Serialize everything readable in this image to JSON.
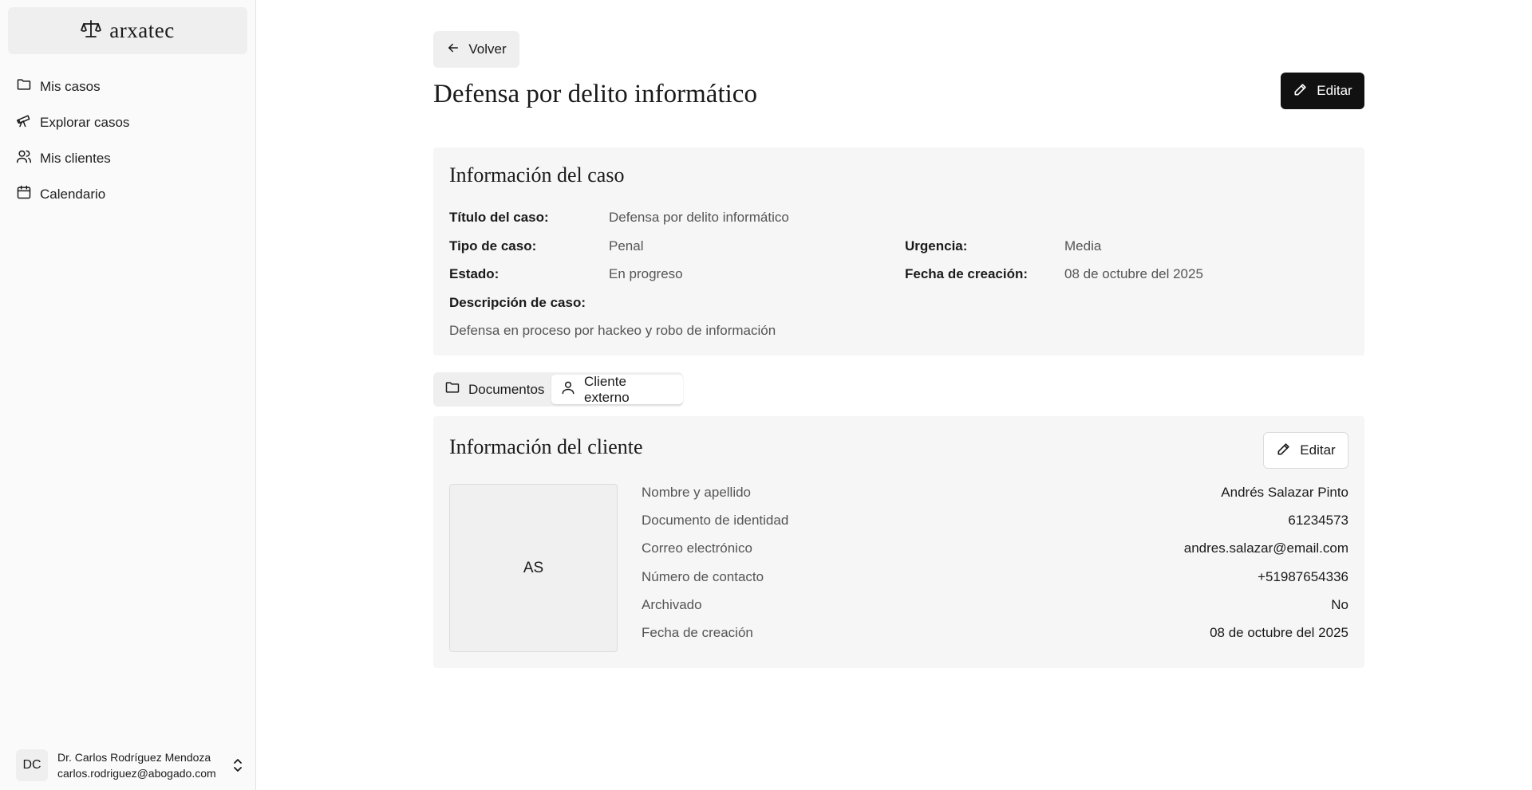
{
  "sidebar": {
    "brand": "arxatec",
    "nav": [
      {
        "label": "Mis casos",
        "icon": "folder-icon"
      },
      {
        "label": "Explorar casos",
        "icon": "telescope-icon"
      },
      {
        "label": "Mis clientes",
        "icon": "users-icon"
      },
      {
        "label": "Calendario",
        "icon": "calendar-icon"
      }
    ],
    "user": {
      "initials": "DC",
      "name": "Dr. Carlos Rodríguez Mendoza",
      "email": "carlos.rodriguez@abogado.com"
    }
  },
  "header": {
    "back_label": "Volver",
    "title": "Defensa por delito informático",
    "edit_label": "Editar"
  },
  "case": {
    "heading": "Información del caso",
    "title_label": "Título del caso:",
    "title_value": "Defensa por delito informático",
    "type_label": "Tipo de caso:",
    "type_value": "Penal",
    "urgency_label": "Urgencia:",
    "urgency_value": "Media",
    "status_label": "Estado:",
    "status_value": "En progreso",
    "created_label": "Fecha de creación:",
    "created_value": "08 de octubre del 2025",
    "description_label": "Descripción de caso:",
    "description_value": "Defensa en proceso por hackeo y robo de información"
  },
  "tabs": {
    "documents": "Documentos",
    "client": "Cliente externo",
    "active": "client"
  },
  "client": {
    "heading": "Información del cliente",
    "edit_label": "Editar",
    "initials": "AS",
    "fields": [
      {
        "label": "Nombre y apellido",
        "value": "Andrés Salazar Pinto"
      },
      {
        "label": "Documento de identidad",
        "value": "61234573"
      },
      {
        "label": "Correo electrónico",
        "value": "andres.salazar@email.com"
      },
      {
        "label": "Número de contacto",
        "value": "+51987654336"
      },
      {
        "label": "Archivado",
        "value": "No"
      },
      {
        "label": "Fecha de creación",
        "value": "08 de octubre del 2025"
      }
    ]
  }
}
